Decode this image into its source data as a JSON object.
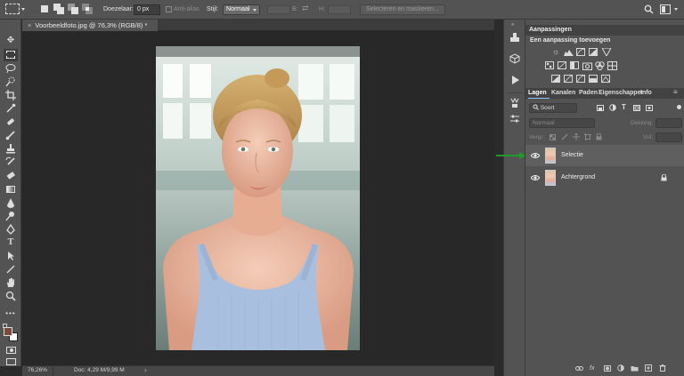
{
  "options_bar": {
    "feather_label": "Doezelaar:",
    "feather_value": "0 px",
    "antialias_label": "Anti-alias",
    "style_label": "Stijl:",
    "style_value": "Normaal",
    "width_label": "B:",
    "height_label": "H:",
    "select_mask_label": "Selecteren en maskeren..."
  },
  "document": {
    "tab_title": "Voorbeeldfoto.jpg @ 76,3% (RGB/8) *"
  },
  "status_bar": {
    "zoom": "76,26%",
    "doc_size": "Doc: 4,29 M/9,99 M"
  },
  "adjustments_panel": {
    "title": "Aanpassingen",
    "subtitle": "Een aanpassing toevoegen"
  },
  "layers_panel": {
    "tabs": [
      "Lagen",
      "Kanalen",
      "Paden",
      "Eigenschapper",
      "Info"
    ],
    "filter_kind": "Soort",
    "blend_mode": "Normaal",
    "opacity_label": "Dekking:",
    "lock_label": "Vergr.:",
    "fill_label": "Vul:",
    "layers": [
      {
        "name": "Selectie",
        "selected": true
      },
      {
        "name": "Achtergrond",
        "selected": false,
        "locked": true
      }
    ]
  },
  "colors": {
    "foreground": "#7a4a3a",
    "background": "#ffffff",
    "panel_bg": "#535353",
    "arrow": "#1e9b2a"
  }
}
